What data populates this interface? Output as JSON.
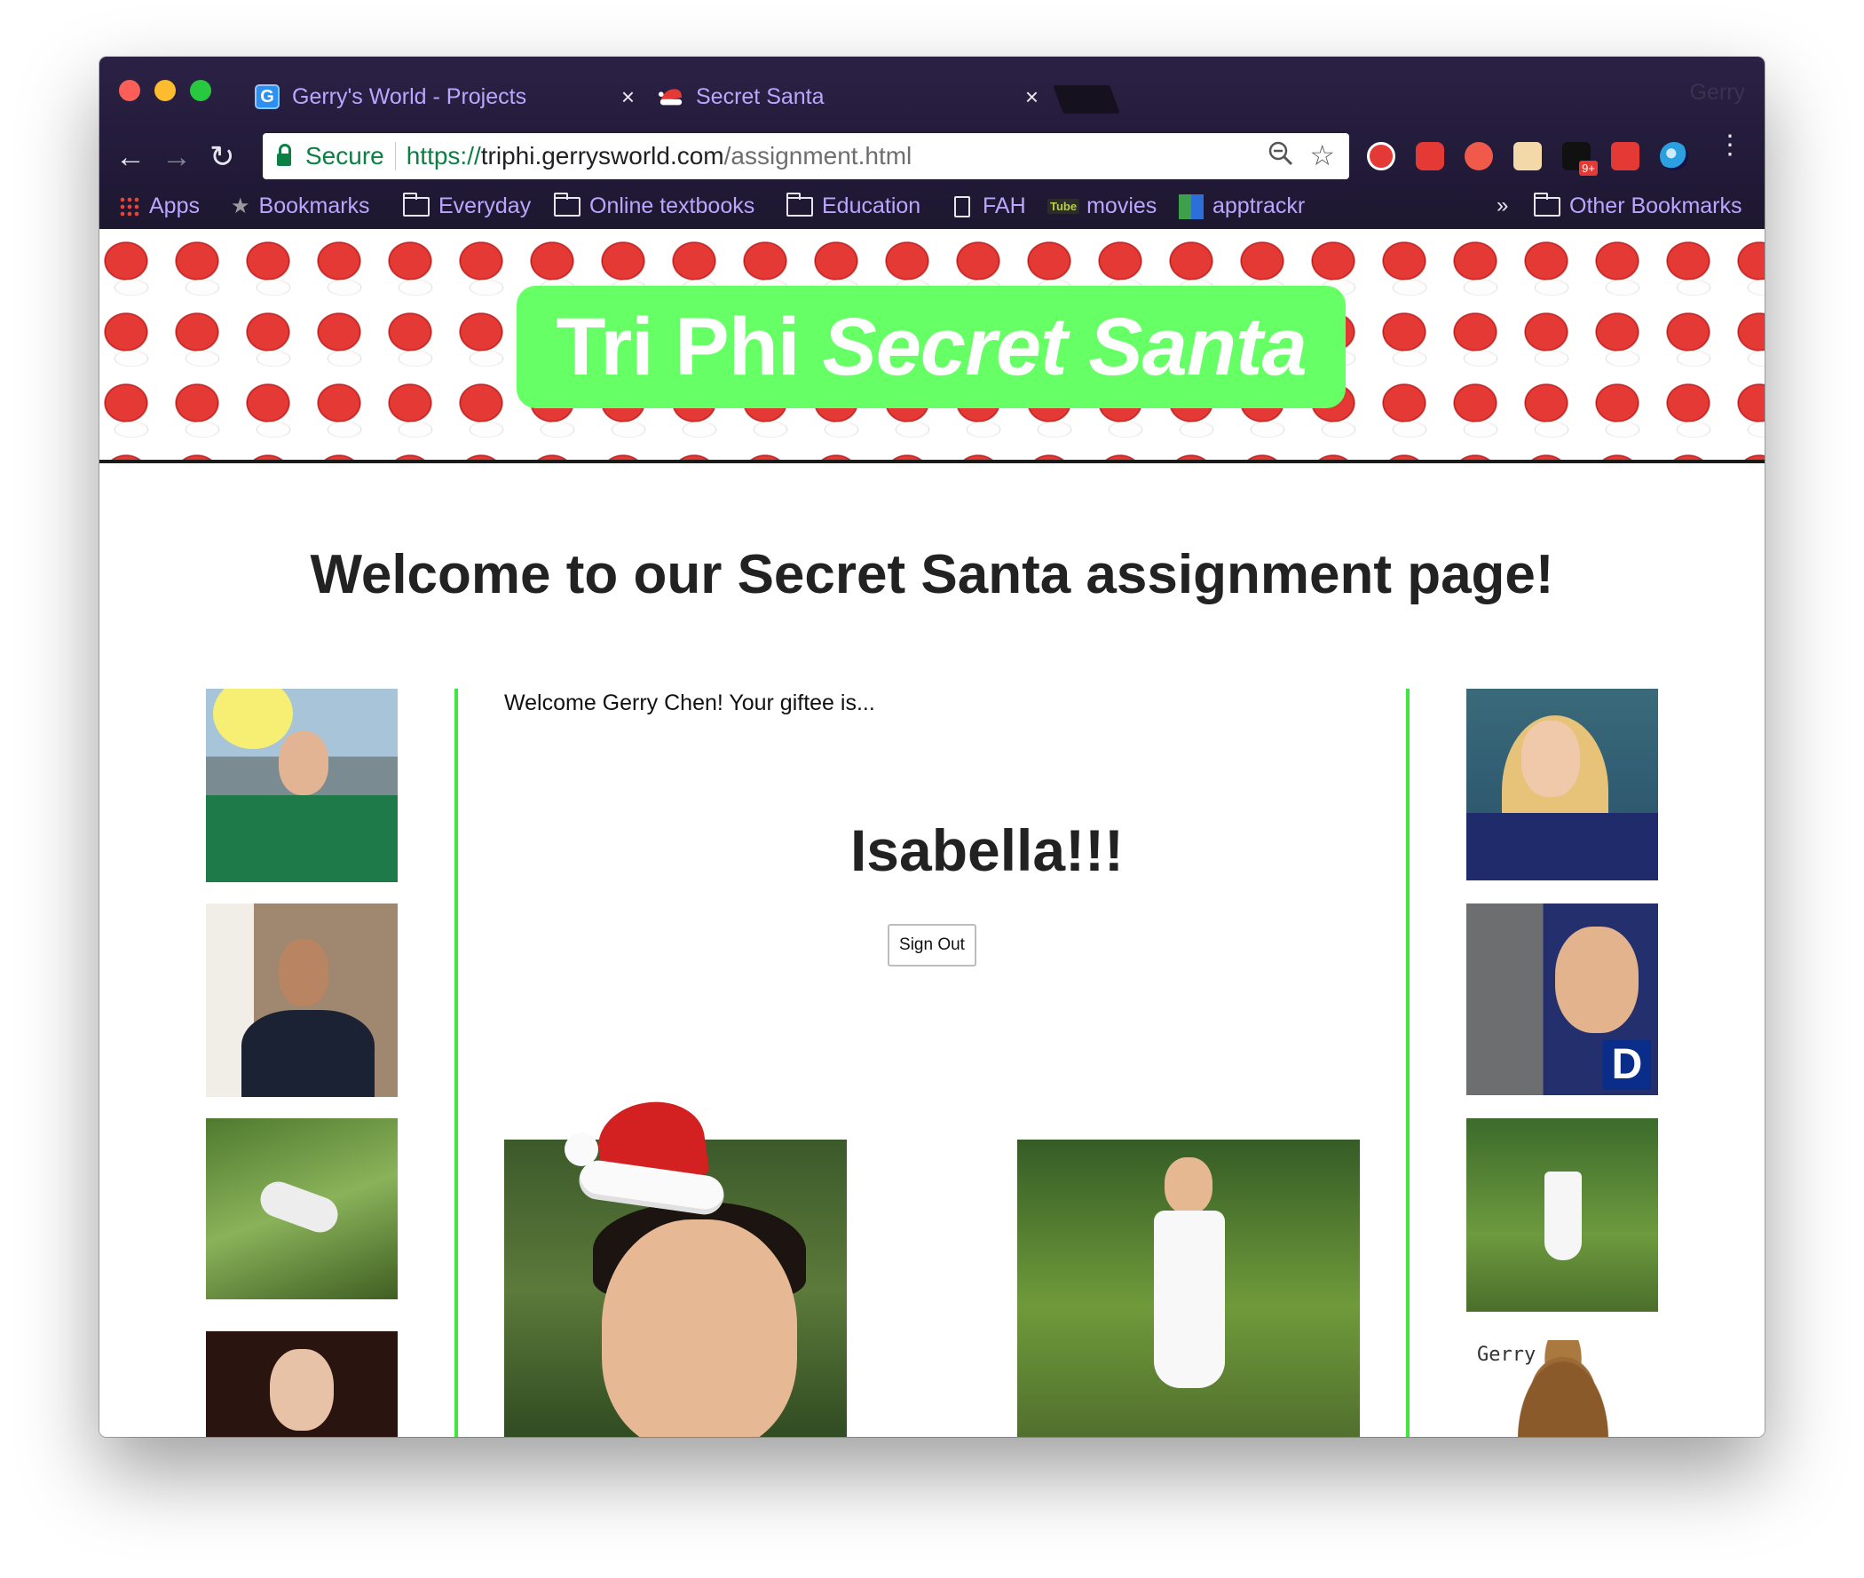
{
  "browser": {
    "tabs": [
      {
        "title": "Gerry's World - Projects",
        "favicon": "G",
        "active": false
      },
      {
        "title": "Secret Santa",
        "favicon": "santa-hat",
        "active": true
      }
    ],
    "tab_close_glyph": "×",
    "profile_name": "Gerry",
    "address": {
      "secure_label": "Secure",
      "scheme": "https://",
      "host": "triphi.gerrysworld.com",
      "path": "/assignment.html"
    },
    "bookmarks": [
      {
        "label": "Apps",
        "icon": "apps-grid-icon"
      },
      {
        "label": "Bookmarks",
        "icon": "star-icon"
      },
      {
        "label": "Everyday",
        "icon": "folder-icon"
      },
      {
        "label": "Online textbooks",
        "icon": "folder-icon"
      },
      {
        "label": "Education",
        "icon": "folder-icon"
      },
      {
        "label": "FAH",
        "icon": "document-icon"
      },
      {
        "label": "movies",
        "icon": "tube-icon"
      },
      {
        "label": "apptrackr",
        "icon": "apptrackr-icon"
      },
      {
        "label": "Other Bookmarks",
        "icon": "folder-icon"
      }
    ],
    "overflow_glyph": "»",
    "tube_text": "Tube",
    "ext_badge": "9+"
  },
  "page": {
    "banner": {
      "title_plain": "Tri Phi",
      "title_emphasis": "Secret Santa"
    },
    "heading": "Welcome to our Secret Santa assignment page!",
    "greeting": "Welcome Gerry Chen! Your giftee is...",
    "giftee": "Isabella!!!",
    "sign_out_label": "Sign Out",
    "sticker_label": "Gerry"
  },
  "colors": {
    "accent_green": "#66ff66",
    "rule_green": "#3ee63e",
    "chrome_bg": "#231b3a",
    "tab_text": "#b9a7ff",
    "secure_green": "#0b8043"
  }
}
